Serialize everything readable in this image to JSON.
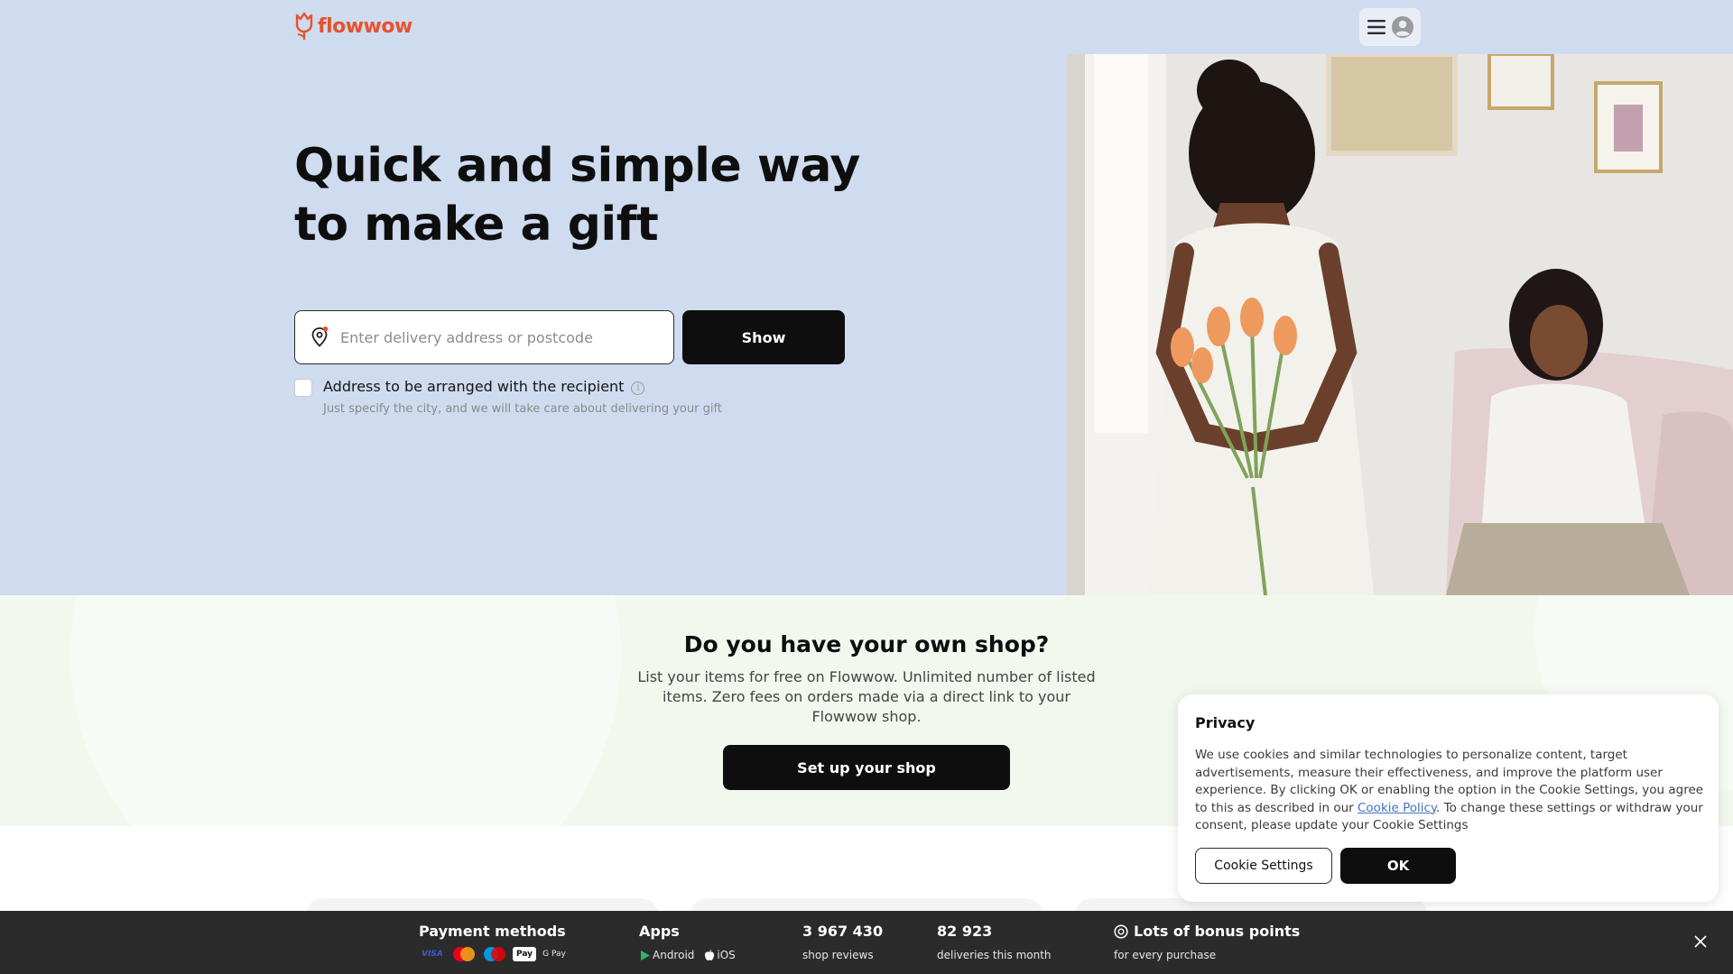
{
  "header": {
    "logo_text": "flowwow",
    "menu_icon": "hamburger-icon",
    "account_icon": "user-avatar-icon",
    "brand_color": "#e5532d"
  },
  "hero": {
    "headline": "Quick and simple way to make a gift",
    "address_placeholder": "Enter delivery address or postcode",
    "address_value": "",
    "show_button": "Show",
    "checkbox_checked": false,
    "checkbox_label": "Address to be arranged with the recipient",
    "checkbox_hint": "Just specify the city, and we will take care about delivering your gift",
    "background_color": "#cfdbef"
  },
  "promo": {
    "title": "Do you have your own shop?",
    "text": "List your items for free on Flowwow. Unlimited number of listed items. Zero fees on orders made via a direct link to your Flowwow shop.",
    "button": "Set up your shop"
  },
  "cookie": {
    "title": "Privacy",
    "text_before": "We use cookies and similar technologies to personalize content, target advertisements, measure their effectiveness, and improve the platform user experience. By clicking OK or enabling the option in the Cookie Settings, you agree to this as described in our ",
    "link": "Cookie Policy",
    "text_after": ". To change these settings or withdraw your consent, please update your Cookie Settings",
    "settings_button": "Cookie Settings",
    "ok_button": "OK"
  },
  "bottom_bar": {
    "payment_title": "Payment methods",
    "payment_icons": [
      "VISA",
      "Mastercard",
      "Maestro",
      "Pay",
      "G Pay"
    ],
    "apps_title": "Apps",
    "android": "Android",
    "ios": "iOS",
    "reviews_count": "3 967 430",
    "reviews_label": "shop reviews",
    "deliveries_count": "82 923",
    "deliveries_label": "deliveries this month",
    "bonus_title": "Lots of bonus points",
    "bonus_sub": "for every purchase"
  }
}
